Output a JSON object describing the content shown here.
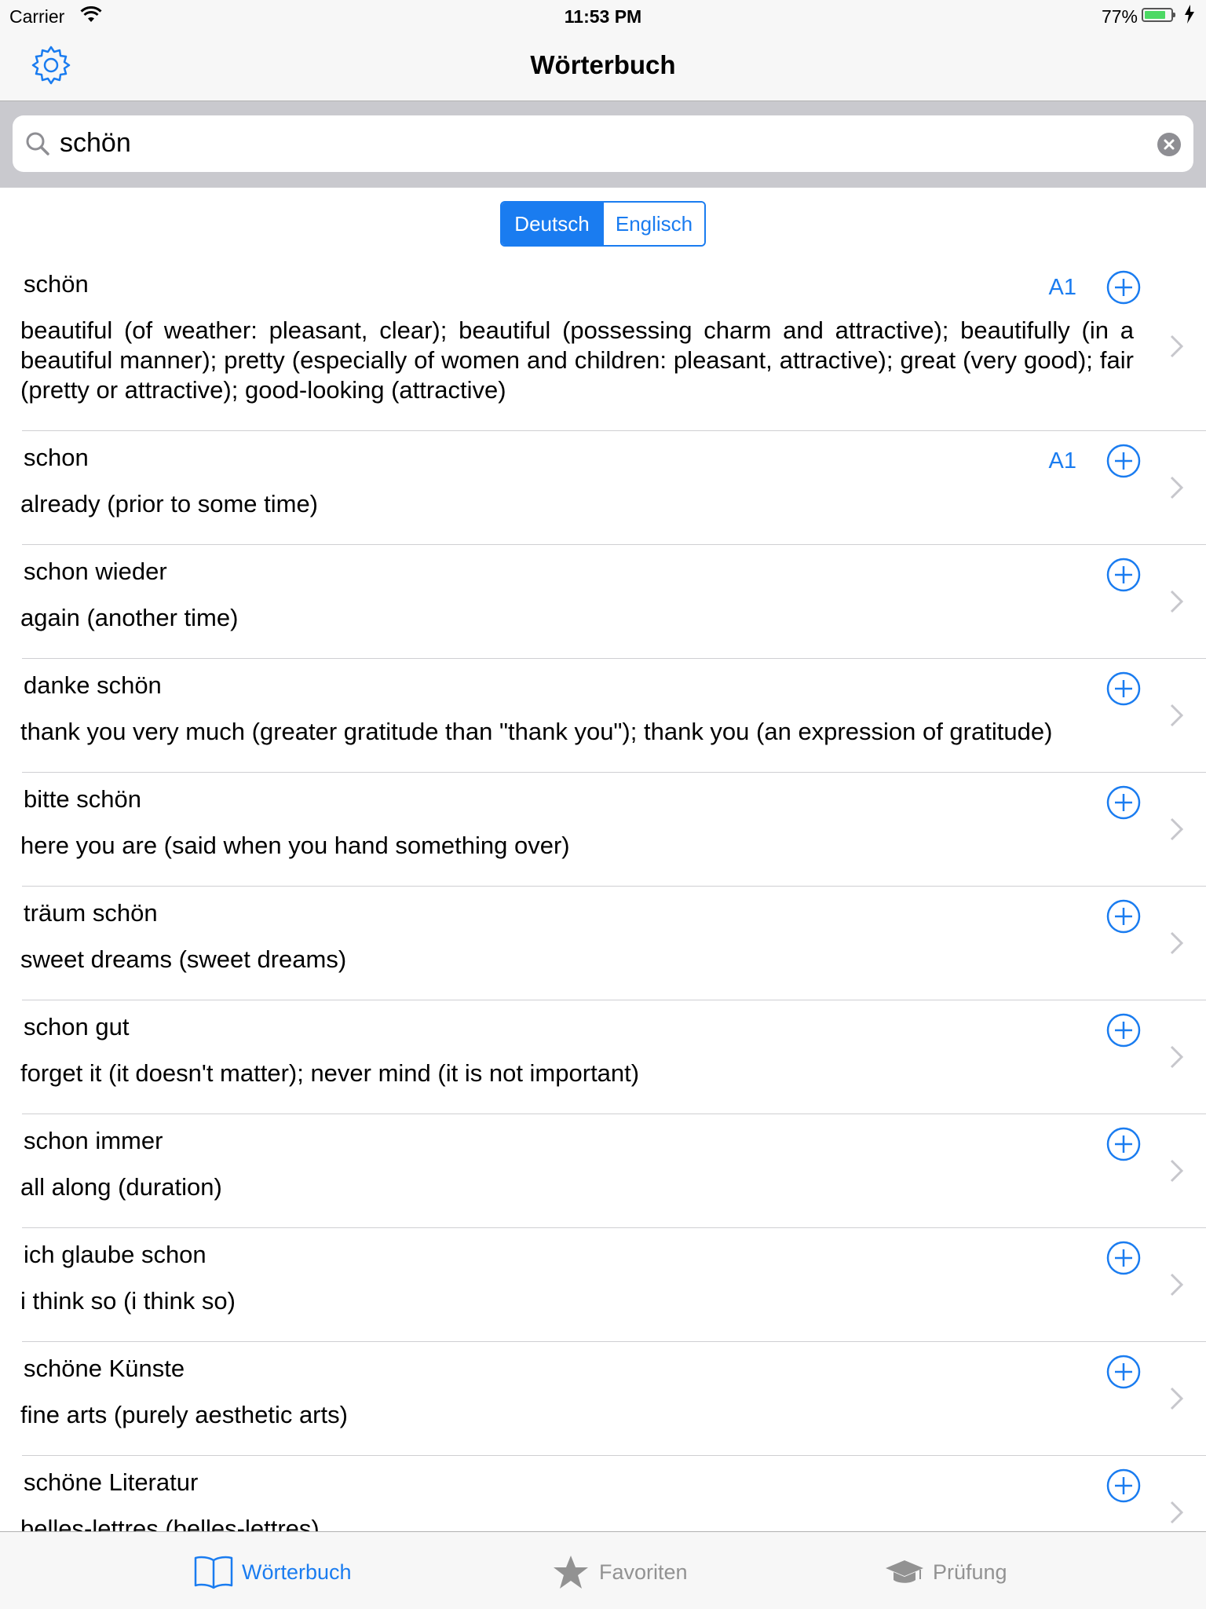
{
  "status_bar": {
    "carrier": "Carrier",
    "time": "11:53 PM",
    "battery_percent": "77%",
    "battery_level": 0.77
  },
  "nav": {
    "title": "Wörterbuch",
    "settings_icon": "gear-icon"
  },
  "search": {
    "value": "schön",
    "clear_icon": "clear-icon"
  },
  "language_toggle": {
    "options": [
      "Deutsch",
      "Englisch"
    ],
    "selected": "Deutsch"
  },
  "entries": [
    {
      "term": "schön",
      "level": "A1",
      "definition": "beautiful (of weather: pleasant, clear); beautiful (possessing charm and attractive); beautifully (in a beautiful manner); pretty (especially of women and children: pleasant, attractive); great (very good); fair (pretty or attractive); good-looking (attractive)"
    },
    {
      "term": "schon",
      "level": "A1",
      "definition": "already (prior to some time)"
    },
    {
      "term": "schon wieder",
      "level": "",
      "definition": "again (another time)"
    },
    {
      "term": "danke schön",
      "level": "",
      "definition": "thank you very much (greater gratitude than \"thank you\"); thank you (an expression of gratitude)"
    },
    {
      "term": "bitte schön",
      "level": "",
      "definition": "here you are (said when you hand something over)"
    },
    {
      "term": "träum schön",
      "level": "",
      "definition": "sweet dreams (sweet dreams)"
    },
    {
      "term": "schon gut",
      "level": "",
      "definition": "forget it (it doesn't matter); never mind (it is not important)"
    },
    {
      "term": "schon immer",
      "level": "",
      "definition": "all along (duration)"
    },
    {
      "term": "ich glaube schon",
      "level": "",
      "definition": "i think so (i think so)"
    },
    {
      "term": "schöne Künste",
      "level": "",
      "definition": "fine arts (purely aesthetic arts)"
    },
    {
      "term": "schöne Literatur",
      "level": "",
      "definition": "belles-lettres (belles-lettres)"
    }
  ],
  "tab_bar": {
    "tabs": [
      {
        "label": "Wörterbuch",
        "icon": "book-icon",
        "active": true
      },
      {
        "label": "Favoriten",
        "icon": "star-icon",
        "active": false
      },
      {
        "label": "Prüfung",
        "icon": "graduation-cap-icon",
        "active": false
      }
    ]
  },
  "colors": {
    "accent": "#1a7cf0",
    "inactive_tab": "#929292",
    "search_bar_bg": "#c9c9ce",
    "battery_fill": "#4cd964"
  }
}
